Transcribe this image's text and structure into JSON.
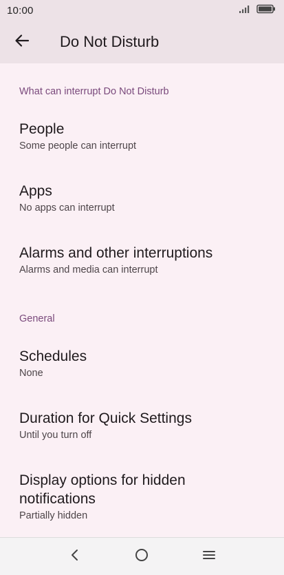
{
  "status_bar": {
    "time": "10:00"
  },
  "app_bar": {
    "title": "Do Not Disturb"
  },
  "sections": {
    "interrupt": {
      "header": "What can interrupt Do Not Disturb",
      "people": {
        "title": "People",
        "subtitle": "Some people can interrupt"
      },
      "apps": {
        "title": "Apps",
        "subtitle": "No apps can interrupt"
      },
      "alarms": {
        "title": "Alarms and other interruptions",
        "subtitle": "Alarms and media can interrupt"
      }
    },
    "general": {
      "header": "General",
      "schedules": {
        "title": "Schedules",
        "subtitle": "None"
      },
      "duration": {
        "title": "Duration for Quick Settings",
        "subtitle": "Until you turn off"
      },
      "display": {
        "title": "Display options for hidden notifications",
        "subtitle": "Partially hidden"
      }
    }
  },
  "colors": {
    "background": "#fbf0f5",
    "app_bar": "#ede2e7",
    "section_header": "#7a4a7c",
    "nav_bar": "#f4f3f4"
  },
  "icons": {
    "back": "arrow-left-icon",
    "signal": "signal-icon",
    "battery": "battery-icon",
    "nav_back": "chevron-left-icon",
    "nav_home": "circle-home-icon",
    "nav_menu": "menu-icon"
  }
}
